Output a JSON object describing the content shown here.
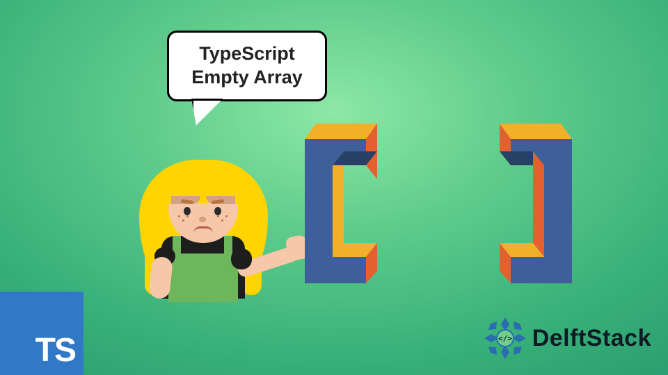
{
  "speech": {
    "line1": "TypeScript",
    "line2": "Empty Array"
  },
  "ts_logo": {
    "label": "TS"
  },
  "brand": {
    "name": "DelftStack"
  },
  "colors": {
    "ts_blue": "#3178c6",
    "bracket_blue": "#3f5f9a",
    "bracket_yellow": "#f2af2a",
    "bracket_orange": "#e4602e",
    "hair_yellow": "#ffd400",
    "apron_green": "#6db65b"
  }
}
